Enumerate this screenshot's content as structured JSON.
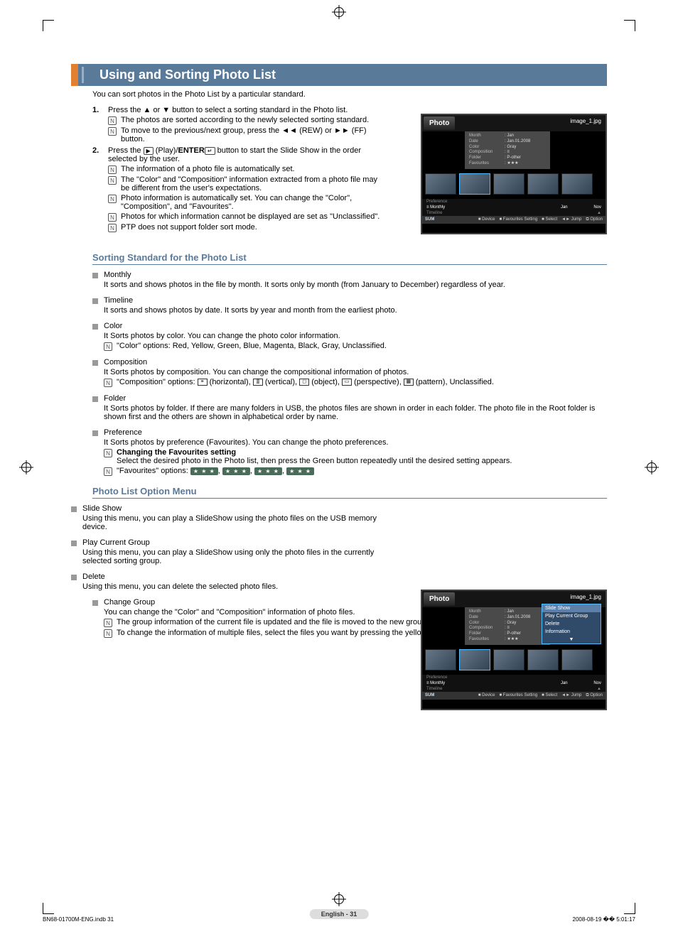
{
  "title": "Using and Sorting Photo List",
  "intro": "You can sort photos in the Photo List by a particular standard.",
  "steps": [
    {
      "num": "1.",
      "text": "Press the ▲ or ▼ button to select a sorting standard in the Photo list.",
      "notes": [
        "The photos are sorted according to the newly selected sorting standard.",
        "To move to the previous/next group, press the ◄◄ (REW) or ►► (FF) button."
      ]
    },
    {
      "num": "2.",
      "text_prefix": "Press the ",
      "text_mid": " (Play)/",
      "text_bold": "ENTER",
      "text_suffix": " button to start the Slide Show in the order selected by the user.",
      "notes": [
        "The information of a photo file is automatically set.",
        "The \"Color\" and \"Composition\" information extracted from a photo file may be different from the user's expectations.",
        "Photo information is automatically set. You can change the \"Color\", \"Composition\", and \"Favourites\".",
        "Photos for which information cannot be displayed are set as \"Unclassified\".",
        "PTP does not support folder sort mode."
      ]
    }
  ],
  "section1_title": "Sorting Standard for the Photo List",
  "sorts": [
    {
      "title": "Monthly",
      "body": "It sorts and shows photos in the file by month. It sorts only by month (from January to December) regardless of year."
    },
    {
      "title": "Timeline",
      "body": "It sorts and shows photos by date. It sorts by year and month from the earliest photo."
    },
    {
      "title": "Color",
      "body": "It Sorts photos by color. You can change the photo color information.",
      "note": "\"Color\" options: Red, Yellow, Green, Blue, Magenta, Black, Gray, Unclassified."
    },
    {
      "title": "Composition",
      "body": "It Sorts photos by composition. You can change the compositional information of photos.",
      "note_prefix": "\"Composition\" options: ",
      "comp_opts": [
        {
          "icon": "≡",
          "label": "(horizontal)"
        },
        {
          "icon": "⫿⫿",
          "label": "(vertical)"
        },
        {
          "icon": "◻",
          "label": "(object)"
        },
        {
          "icon": "▭",
          "label": "(perspective)"
        },
        {
          "icon": "▦",
          "label": "(pattern)"
        }
      ],
      "note_suffix": ", Unclassified."
    },
    {
      "title": "Folder",
      "body": "It Sorts photos by folder. If there are many folders in USB, the photos files are shown in order in each folder. The photo file in the Root folder is shown first and the others are shown in alphabetical order by name."
    },
    {
      "title": "Preference",
      "body": "It Sorts photos by preference (Favourites). You can change the photo preferences.",
      "note_bold": "Changing the Favourites setting",
      "note_body": "Select the desired photo in the Photo list, then press the Green button repeatedly until the desired setting appears.",
      "note2_prefix": "\"Favourites\" options: ",
      "fav_opts": [
        "★ ★ ★",
        "★ ★ ★",
        "★ ★ ★",
        "★ ★ ★"
      ]
    }
  ],
  "section2_title": "Photo List Option Menu",
  "options": [
    {
      "title": "Slide Show",
      "body": "Using this menu, you can play a SlideShow using the photo files on the USB memory device."
    },
    {
      "title": "Play Current Group",
      "body": "Using this menu, you can play a SlideShow using only the photo files in the currently selected sorting group."
    },
    {
      "title": "Delete",
      "body": "Using this menu, you can delete the selected photo files."
    },
    {
      "title": "Change Group",
      "body": "You can change the \"Color\" and \"Composition\" information of photo files.",
      "notes": [
        "The group information of the current file is updated and the file is moved to the new group.",
        "To change the information of multiple files, select the files you want by pressing the yellow button."
      ]
    }
  ],
  "tv": {
    "header_left": "Photo",
    "header_right": "image_1.jpg",
    "meta": [
      {
        "k": "Month",
        "v": ": Jan"
      },
      {
        "k": "Date",
        "v": ": Jan.01.2008"
      },
      {
        "k": "Color",
        "v": ": Gray"
      },
      {
        "k": "Composition",
        "v": ": ≡"
      },
      {
        "k": "Folder",
        "v": ": P-other"
      },
      {
        "k": "Favourites",
        "v": ": ★★★"
      }
    ],
    "sortrows": [
      "Preference",
      "Monthly",
      "Timeline"
    ],
    "sort_left": "Jan",
    "sort_right": "Nov",
    "footer": {
      "sum": "SUM",
      "device": "Device",
      "fav": "Favourites Setting",
      "select": "Select",
      "jump": "Jump",
      "option": "Option"
    },
    "menu": [
      "Slide Show",
      "Play Current Group",
      "Delete",
      "Information",
      "▼"
    ]
  },
  "page_num": "English - 31",
  "foot_left": "BN68-01700M-ENG.indb   31",
  "foot_right": "2008-08-19   �� 5:01:17"
}
